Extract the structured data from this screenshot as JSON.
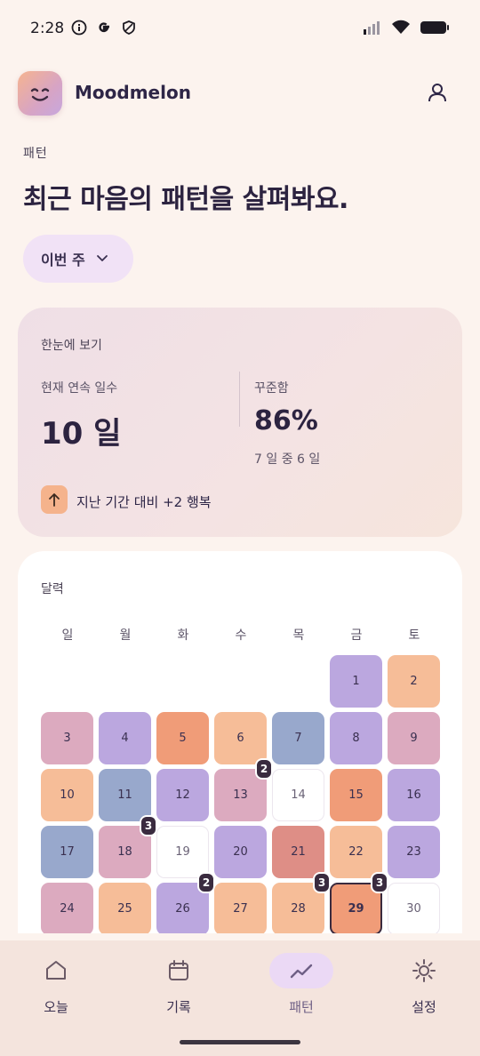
{
  "status_bar": {
    "time": "2:28",
    "left_icons": [
      "info-icon",
      "google-icon",
      "shield-icon"
    ],
    "right_icons": [
      "signal-icon",
      "wifi-icon",
      "battery-icon"
    ]
  },
  "header": {
    "app_name": "Moodmelon",
    "logo_icon": "smile-face-icon",
    "profile_icon": "person-icon"
  },
  "page": {
    "section_label": "패턴",
    "title": "최근 마음의 패턴을 살펴봐요.",
    "period_selector": {
      "value": "이번 주",
      "icon": "chevron-down-icon"
    }
  },
  "summary": {
    "heading": "한눈에 보기",
    "streak_label": "현재 연속 일수",
    "streak_value": "10 일",
    "consistency_label": "꾸준함",
    "consistency_value": "86%",
    "consistency_sub": "7 일 중 6 일",
    "trend_icon": "arrow-up-icon",
    "trend_text": "지난 기간 대비 +2 행복"
  },
  "calendar": {
    "heading": "달력",
    "weekdays": [
      "일",
      "월",
      "화",
      "수",
      "목",
      "금",
      "토"
    ],
    "first_weekday_index": 5,
    "mood_colors": {
      "lavender": "#bba7df",
      "peach": "#f6bd98",
      "orange": "#f09c78",
      "pink": "#dcaabf",
      "blue": "#98a8cc",
      "red": "#de8e86",
      "none": "#ffffff"
    },
    "days": [
      {
        "day": "1",
        "mood": "lavender"
      },
      {
        "day": "2",
        "mood": "peach"
      },
      {
        "day": "3",
        "mood": "pink"
      },
      {
        "day": "4",
        "mood": "lavender"
      },
      {
        "day": "5",
        "mood": "orange"
      },
      {
        "day": "6",
        "mood": "peach"
      },
      {
        "day": "7",
        "mood": "blue"
      },
      {
        "day": "8",
        "mood": "lavender"
      },
      {
        "day": "9",
        "mood": "pink"
      },
      {
        "day": "10",
        "mood": "peach"
      },
      {
        "day": "11",
        "mood": "blue"
      },
      {
        "day": "12",
        "mood": "lavender"
      },
      {
        "day": "13",
        "mood": "pink",
        "count": "2"
      },
      {
        "day": "14",
        "mood": "none"
      },
      {
        "day": "15",
        "mood": "orange"
      },
      {
        "day": "16",
        "mood": "lavender"
      },
      {
        "day": "17",
        "mood": "blue"
      },
      {
        "day": "18",
        "mood": "pink",
        "count": "3"
      },
      {
        "day": "19",
        "mood": "none"
      },
      {
        "day": "20",
        "mood": "lavender"
      },
      {
        "day": "21",
        "mood": "red"
      },
      {
        "day": "22",
        "mood": "peach"
      },
      {
        "day": "23",
        "mood": "lavender"
      },
      {
        "day": "24",
        "mood": "pink"
      },
      {
        "day": "25",
        "mood": "peach"
      },
      {
        "day": "26",
        "mood": "lavender",
        "count": "2"
      },
      {
        "day": "27",
        "mood": "peach"
      },
      {
        "day": "28",
        "mood": "peach",
        "count": "3"
      },
      {
        "day": "29",
        "mood": "orange",
        "count": "3",
        "today": true
      },
      {
        "day": "30",
        "mood": "none"
      }
    ]
  },
  "nav": {
    "items": [
      {
        "label": "오늘",
        "icon": "home-icon",
        "active": false
      },
      {
        "label": "기록",
        "icon": "calendar-icon",
        "active": false
      },
      {
        "label": "패턴",
        "icon": "trend-line-icon",
        "active": true
      },
      {
        "label": "설정",
        "icon": "sun-settings-icon",
        "active": false
      }
    ]
  }
}
